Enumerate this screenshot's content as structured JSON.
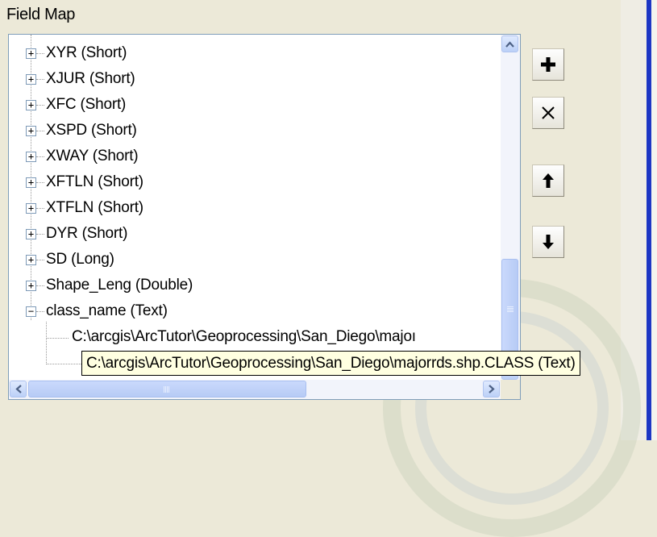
{
  "title": "Field Map",
  "tree": {
    "items": [
      {
        "label": "XYR (Short)",
        "expander": "+"
      },
      {
        "label": "XJUR (Short)",
        "expander": "+"
      },
      {
        "label": "XFC (Short)",
        "expander": "+"
      },
      {
        "label": "XSPD (Short)",
        "expander": "+"
      },
      {
        "label": "XWAY (Short)",
        "expander": "+"
      },
      {
        "label": "XFTLN (Short)",
        "expander": "+"
      },
      {
        "label": "XTFLN (Short)",
        "expander": "+"
      },
      {
        "label": "DYR (Short)",
        "expander": "+"
      },
      {
        "label": "SD (Long)",
        "expander": "+"
      },
      {
        "label": "Shape_Leng (Double)",
        "expander": "+"
      },
      {
        "label": "class_name (Text)",
        "expander": "−"
      }
    ],
    "children": [
      {
        "label": "C:\\arcgis\\ArcTutor\\Geoprocessing\\San_Diego\\majoı"
      }
    ],
    "tooltip": "C:\\arcgis\\ArcTutor\\Geoprocessing\\San_Diego\\majorrds.shp.CLASS (Text)"
  },
  "toolbar": {
    "add": "add-icon",
    "remove": "delete-icon",
    "move_up": "arrow-up-icon",
    "move_down": "arrow-down-icon"
  },
  "colors": {
    "background": "#ECE9D8",
    "tooltip_bg": "#FFFFE1",
    "scroll_accent": "#BBD0F7",
    "blue_line": "#1D36C4"
  }
}
